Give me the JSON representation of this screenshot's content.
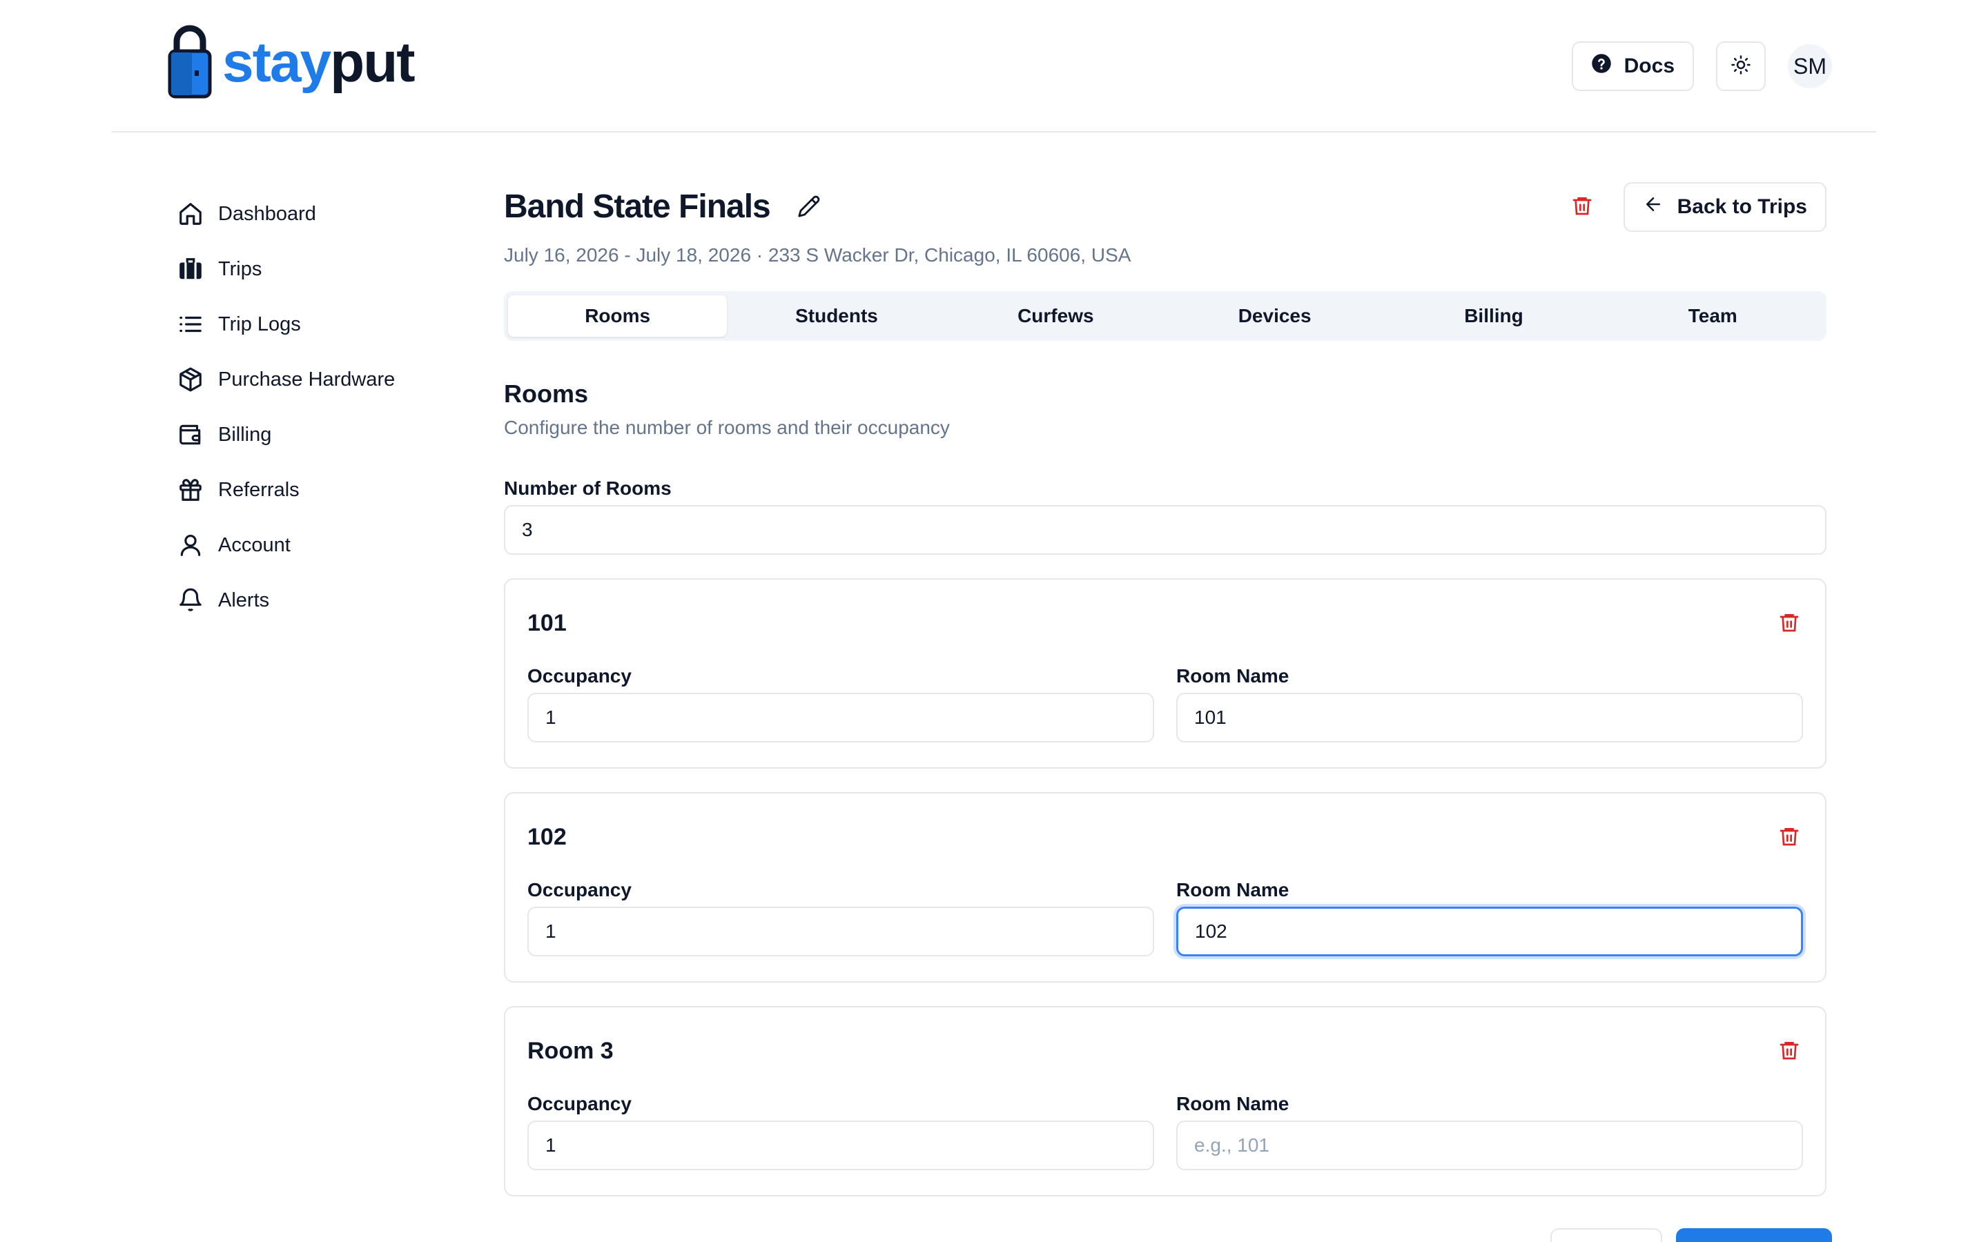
{
  "brand": {
    "name_part1": "stay",
    "name_part2": "put"
  },
  "header": {
    "docs_label": "Docs",
    "avatar_initials": "SM"
  },
  "sidebar": {
    "items": [
      {
        "label": "Dashboard",
        "icon": "home-icon"
      },
      {
        "label": "Trips",
        "icon": "luggage-icon"
      },
      {
        "label": "Trip Logs",
        "icon": "list-icon"
      },
      {
        "label": "Purchase Hardware",
        "icon": "package-icon"
      },
      {
        "label": "Billing",
        "icon": "wallet-icon"
      },
      {
        "label": "Referrals",
        "icon": "gift-icon"
      },
      {
        "label": "Account",
        "icon": "user-icon"
      },
      {
        "label": "Alerts",
        "icon": "bell-icon"
      }
    ]
  },
  "trip": {
    "title": "Band State Finals",
    "subtitle": "July 16, 2026 - July 18, 2026 · 233 S Wacker Dr, Chicago, IL 60606, USA",
    "back_label": "Back to Trips"
  },
  "tabs": [
    {
      "label": "Rooms",
      "active": true
    },
    {
      "label": "Students",
      "active": false
    },
    {
      "label": "Curfews",
      "active": false
    },
    {
      "label": "Devices",
      "active": false
    },
    {
      "label": "Billing",
      "active": false
    },
    {
      "label": "Team",
      "active": false
    }
  ],
  "rooms_section": {
    "title": "Rooms",
    "description": "Configure the number of rooms and their occupancy",
    "count_label": "Number of Rooms",
    "count_value": "3",
    "occupancy_label": "Occupancy",
    "room_name_label": "Room Name",
    "room_name_placeholder": "e.g., 101",
    "rooms": [
      {
        "title": "101",
        "occupancy": "1",
        "room_name": "101"
      },
      {
        "title": "102",
        "occupancy": "1",
        "room_name": "102"
      },
      {
        "title": "Room 3",
        "occupancy": "1",
        "room_name": ""
      }
    ]
  },
  "colors": {
    "brand_blue": "#1e7be8",
    "danger_red": "#dc2626",
    "focus_blue": "#3b82f6"
  }
}
